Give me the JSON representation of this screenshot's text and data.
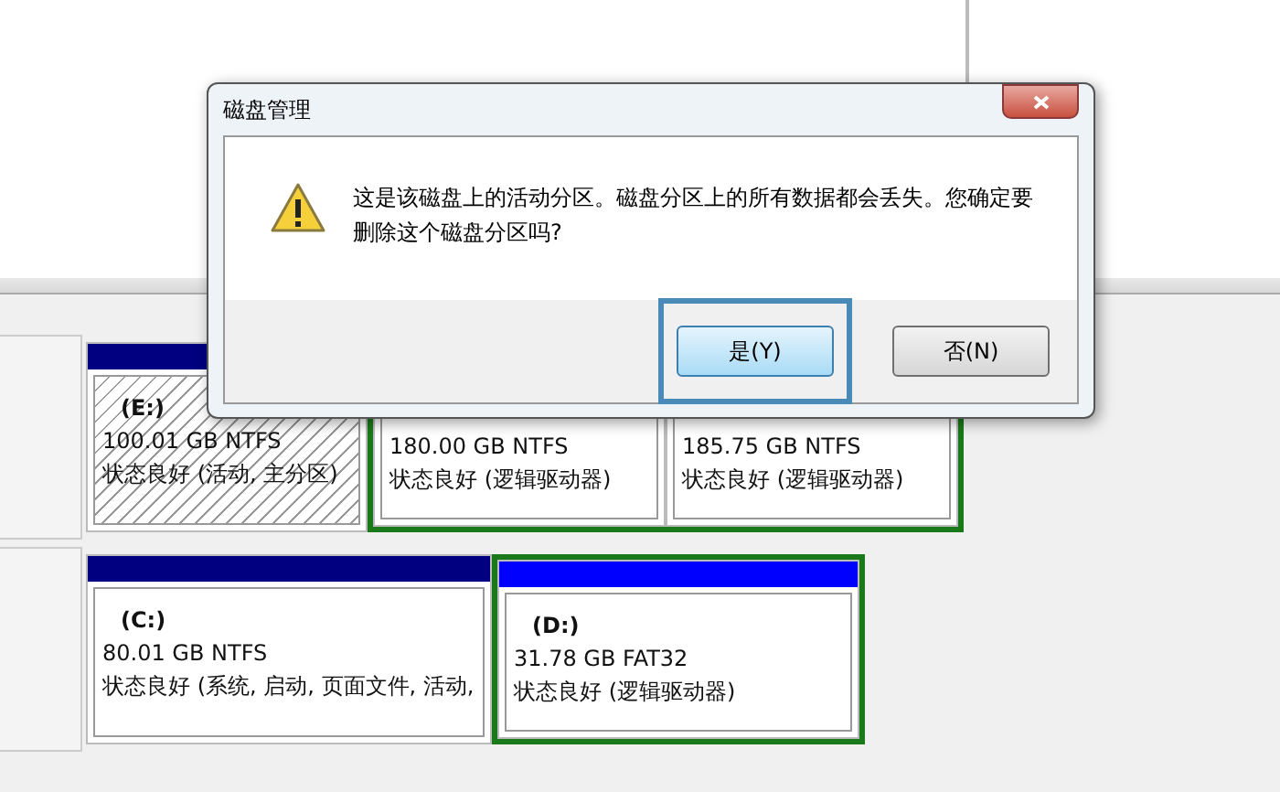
{
  "dialog": {
    "title": "磁盘管理",
    "message": "这是该磁盘上的活动分区。磁盘分区上的所有数据都会丢失。您确定要删除这个磁盘分区吗?",
    "buttons": [
      {
        "label": "是(Y)",
        "focused": true
      },
      {
        "label": "否(N)",
        "focused": false
      }
    ]
  },
  "disks": [
    {
      "partitions": [
        {
          "kind": "primary",
          "selected": true,
          "name": "(E:)",
          "size": "100.01 GB NTFS",
          "status": "状态良好 (活动, 主分区)"
        },
        {
          "kind": "logical",
          "selected": false,
          "size": "180.00 GB NTFS",
          "status": "状态良好 (逻辑驱动器)"
        },
        {
          "kind": "logical",
          "selected": false,
          "size": "185.75 GB NTFS",
          "status": "状态良好 (逻辑驱动器)"
        }
      ]
    },
    {
      "partitions": [
        {
          "kind": "primary",
          "selected": false,
          "name": "(C:)",
          "size": "80.01 GB NTFS",
          "status": "状态良好 (系统, 启动, 页面文件, 活动,"
        },
        {
          "kind": "logical",
          "selected": false,
          "name": "(D:)",
          "size": "31.78 GB FAT32",
          "status": "状态良好 (逻辑驱动器)"
        }
      ]
    }
  ]
}
